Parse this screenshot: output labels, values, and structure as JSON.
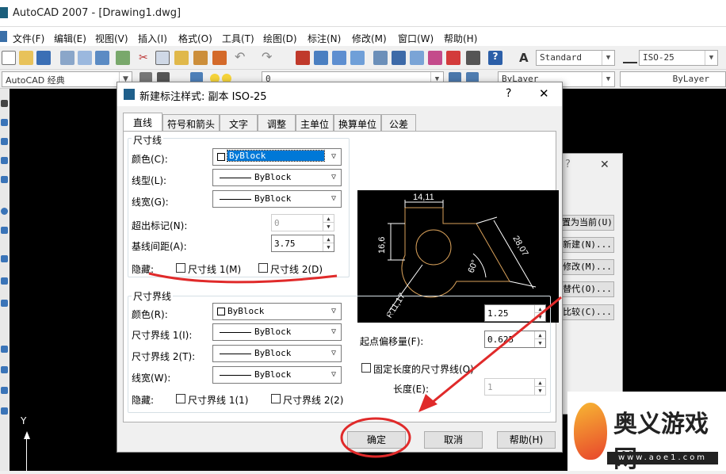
{
  "app": {
    "title": "AutoCAD 2007 - [Drawing1.dwg]"
  },
  "menu": [
    "文件(F)",
    "编辑(E)",
    "视图(V)",
    "插入(I)",
    "格式(O)",
    "工具(T)",
    "绘图(D)",
    "标注(N)",
    "修改(M)",
    "窗口(W)",
    "帮助(H)"
  ],
  "toolbar": {
    "text_style": "Standard",
    "dim_style": "ISO-25",
    "workspace": "AutoCAD 经典",
    "layer": "0",
    "color": "ByLayer",
    "linetype": "ByLayer"
  },
  "bg_dialog": {
    "buttons": [
      "置为当前(U)",
      "新建(N)...",
      "修改(M)...",
      "替代(O)...",
      "比较(C)..."
    ]
  },
  "dialog": {
    "title": "新建标注样式: 副本 ISO-25",
    "help": "?",
    "close": "✕",
    "tabs": [
      "直线",
      "符号和箭头",
      "文字",
      "调整",
      "主单位",
      "换算单位",
      "公差"
    ],
    "dimline": {
      "group": "尺寸线",
      "color_label": "颜色(C):",
      "color_value": "ByBlock",
      "linetype_label": "线型(L):",
      "linetype_value": "ByBlock",
      "lineweight_label": "线宽(G):",
      "lineweight_value": "ByBlock",
      "extend_label": "超出标记(N):",
      "extend_value": "0",
      "baseline_label": "基线间距(A):",
      "baseline_value": "3.75",
      "suppress_label": "隐藏:",
      "chk1": "尺寸线 1(M)",
      "chk2": "尺寸线 2(D)"
    },
    "extline": {
      "group": "尺寸界线",
      "color_label": "颜色(R):",
      "color_value": "ByBlock",
      "lt1_label": "尺寸界线 1(I):",
      "lt1_value": "ByBlock",
      "lt2_label": "尺寸界线 2(T):",
      "lt2_value": "ByBlock",
      "lw_label": "线宽(W):",
      "lw_value": "ByBlock",
      "suppress_label": "隐藏:",
      "chk1": "尺寸界线 1(1)",
      "chk2": "尺寸界线 2(2)",
      "beyond_label": "超出尺寸线(X):",
      "beyond_value": "1.25",
      "offset_label": "起点偏移量(F):",
      "offset_value": "0.625",
      "fixed_label": "固定长度的尺寸界线(O)",
      "length_label": "长度(E):",
      "length_value": "1"
    },
    "preview": {
      "d1": "14,11",
      "d2": "16,6",
      "d3": "28,07",
      "d4": "60°",
      "d5": "R11,17"
    },
    "ok": "确定",
    "cancel": "取消",
    "helpbtn": "帮助(H)"
  },
  "canvas": {
    "axis_y": "Y"
  },
  "watermark": {
    "brand": "奥义游戏网",
    "url": "www.aoe1.com"
  }
}
